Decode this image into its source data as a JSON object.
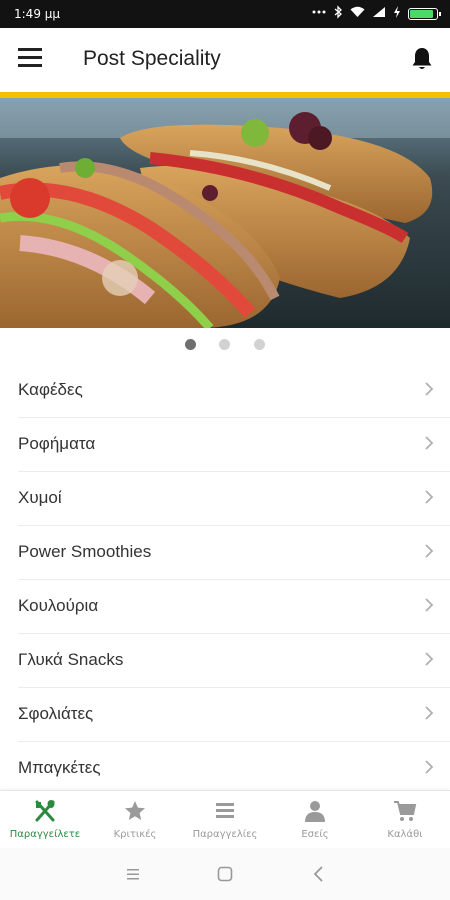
{
  "status_bar": {
    "time": "1:49 μμ",
    "icons": [
      "dots-icon",
      "bluetooth-icon",
      "wifi-icon",
      "signal-icon",
      "charging-icon",
      "battery-icon"
    ]
  },
  "app_bar": {
    "title": "Post Speciality",
    "menu_icon": "hamburger-icon",
    "notification_icon": "bell-icon",
    "accent_color": "#f2c100"
  },
  "carousel": {
    "total_slides": 3,
    "active_index": 0
  },
  "menu": {
    "items": [
      {
        "label": "Καφέδες"
      },
      {
        "label": "Ροφήματα"
      },
      {
        "label": "Χυμοί"
      },
      {
        "label": "Power Smoothies"
      },
      {
        "label": "Κουλούρια"
      },
      {
        "label": "Γλυκά Snacks"
      },
      {
        "label": "Σφολιάτες"
      },
      {
        "label": "Μπαγκέτες"
      }
    ]
  },
  "bottom_nav": {
    "active_color": "#2b8a3e",
    "inactive_color": "#9a9a9a",
    "items": [
      {
        "label": "Παραγγείλετε",
        "icon": "utensils-icon",
        "active": true
      },
      {
        "label": "Κριτικές",
        "icon": "star-icon",
        "active": false
      },
      {
        "label": "Παραγγελίες",
        "icon": "list-icon",
        "active": false
      },
      {
        "label": "Εσείς",
        "icon": "person-icon",
        "active": false
      },
      {
        "label": "Καλάθι",
        "icon": "cart-icon",
        "active": false
      }
    ]
  },
  "system_nav": {
    "buttons": [
      "recents-icon",
      "home-icon",
      "back-icon"
    ]
  }
}
